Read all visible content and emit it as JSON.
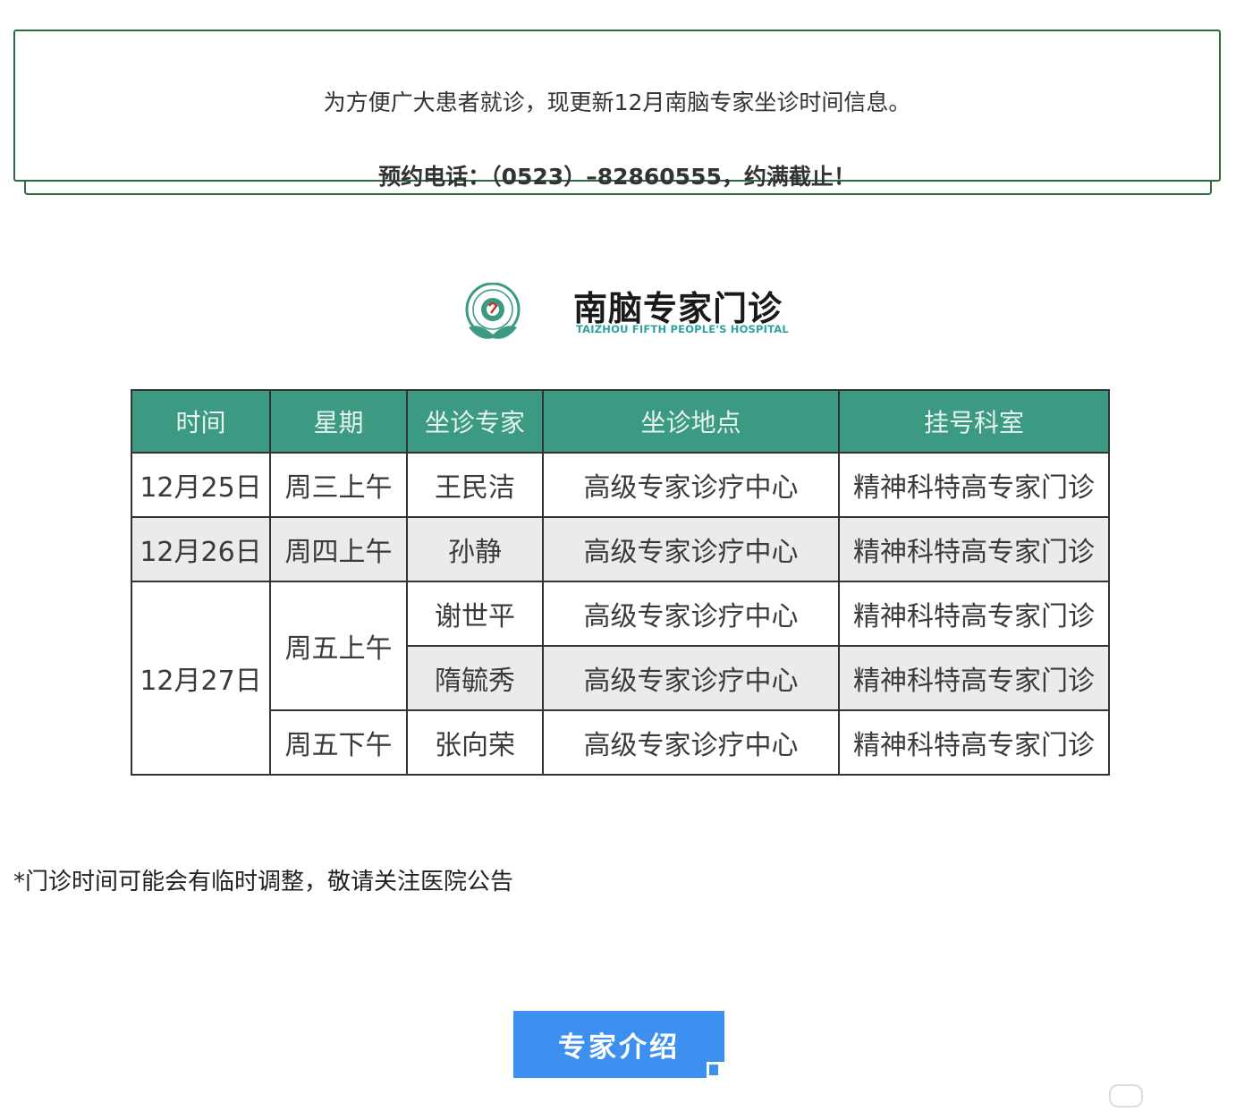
{
  "notice": {
    "line1": "为方便广大患者就诊，现更新12月南脑专家坐诊时间信息。",
    "line2": "预约电话：（0523）–82860555，约满截止！"
  },
  "header": {
    "title": "南脑专家门诊",
    "subtitle": "TAIZHOU FIFTH PEOPLE'S HOSPITAL"
  },
  "table": {
    "headers": [
      "时间",
      "星期",
      "坐诊专家",
      "坐诊地点",
      "挂号科室"
    ],
    "rows": [
      {
        "date": "12月25日",
        "day": "周三上午",
        "expert": "王民洁",
        "location": "高级专家诊疗中心",
        "dept": "精神科特高专家门诊"
      },
      {
        "date": "12月26日",
        "day": "周四上午",
        "expert": "孙静",
        "location": "高级专家诊疗中心",
        "dept": "精神科特高专家门诊"
      },
      {
        "date": "12月27日",
        "day": "周五上午",
        "expert": "谢世平",
        "location": "高级专家诊疗中心",
        "dept": "精神科特高专家门诊"
      },
      {
        "date": "",
        "day": "",
        "expert": "隋毓秀",
        "location": "高级专家诊疗中心",
        "dept": "精神科特高专家门诊"
      },
      {
        "date": "",
        "day": "周五下午",
        "expert": "张向荣",
        "location": "高级专家诊疗中心",
        "dept": "精神科特高专家门诊"
      }
    ]
  },
  "footnote": "*门诊时间可能会有临时调整，敬请关注医院公告",
  "button": {
    "label": "专家介绍"
  },
  "colors": {
    "border_green": "#2e6b3f",
    "table_header": "#3d9a82",
    "button_blue": "#3d8ff0",
    "row_gray": "#ebebeb",
    "subtitle_teal": "#2ea3a0"
  }
}
